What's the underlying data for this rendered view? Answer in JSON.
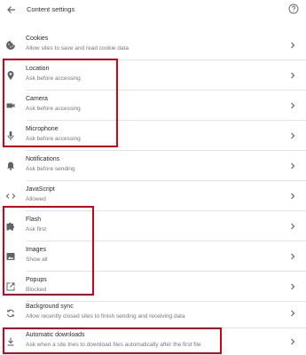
{
  "header": {
    "title": "Content settings",
    "back_icon": "arrow-left-icon",
    "help_icon": "help-circle-icon"
  },
  "colors": {
    "highlight": "#d0021b",
    "icon": "#5f6368",
    "title_text": "#2a2a2a",
    "desc_text": "#777777"
  },
  "settings": [
    {
      "title": "Cookies",
      "desc": "Allow sites to save and read cookie data",
      "icon": "cookie-icon"
    },
    {
      "title": "Location",
      "desc": "Ask before accessing",
      "icon": "location-pin-icon"
    },
    {
      "title": "Camera",
      "desc": "Ask before accessing",
      "icon": "camera-icon"
    },
    {
      "title": "Microphone",
      "desc": "Ask before accessing",
      "icon": "microphone-icon"
    },
    {
      "title": "Notifications",
      "desc": "Ask before sending",
      "icon": "bell-icon"
    },
    {
      "title": "JavaScript",
      "desc": "Allowed",
      "icon": "code-icon"
    },
    {
      "title": "Flash",
      "desc": "Ask first",
      "icon": "puzzle-icon"
    },
    {
      "title": "Images",
      "desc": "Show all",
      "icon": "image-icon"
    },
    {
      "title": "Popups",
      "desc": "Blocked",
      "icon": "external-link-icon"
    },
    {
      "title": "Background sync",
      "desc": "Allow recently closed sites to finish sending and receiving data",
      "icon": "sync-icon"
    },
    {
      "title": "Automatic downloads",
      "desc": "Ask when a site tries to download files automatically after the first file",
      "icon": "download-icon"
    }
  ]
}
